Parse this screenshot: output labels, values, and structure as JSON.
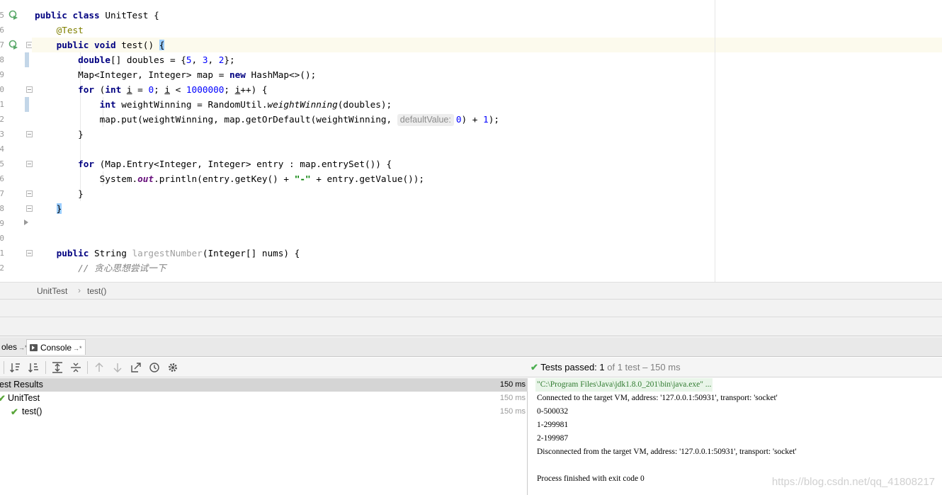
{
  "editor": {
    "line_numbers": [
      "5",
      "6",
      "7",
      "8",
      "9",
      "0",
      "1",
      "2",
      "3",
      "4",
      "5",
      "6",
      "7",
      "8",
      "9",
      "0",
      "1",
      "2"
    ],
    "code_lines": [
      {
        "id": "class-decl",
        "text": "public class UnitTest {"
      },
      {
        "id": "annotation",
        "text": "@Test"
      },
      {
        "id": "method-decl",
        "text": "public void test() {"
      },
      {
        "id": "doubles",
        "text": "double[] doubles = {5, 3, 2};"
      },
      {
        "id": "map-decl",
        "text": "Map<Integer, Integer> map = new HashMap<>();"
      },
      {
        "id": "for-loop",
        "text": "for (int i = 0; i < 1000000; i++) {"
      },
      {
        "id": "weight",
        "text": "int weightWinning = RandomUtil.weightWinning(doubles);"
      },
      {
        "id": "map-put",
        "text": "map.put(weightWinning, map.getOrDefault(weightWinning, defaultValue: 0) + 1);"
      },
      {
        "id": "close1",
        "text": "}"
      },
      {
        "id": "blank1",
        "text": ""
      },
      {
        "id": "for-entry",
        "text": "for (Map.Entry<Integer, Integer> entry : map.entrySet()) {"
      },
      {
        "id": "println",
        "text": "System.out.println(entry.getKey() + \"-\" + entry.getValue());"
      },
      {
        "id": "close2",
        "text": "}"
      },
      {
        "id": "close3",
        "text": "}"
      },
      {
        "id": "blank2",
        "text": ""
      },
      {
        "id": "blank3",
        "text": ""
      },
      {
        "id": "largest",
        "text": "public String largestNumber(Integer[] nums) {"
      },
      {
        "id": "comment",
        "text": "// 贪心思想尝试一下"
      }
    ],
    "tokens": {
      "public": "public",
      "class": "class",
      "class_name": "UnitTest {",
      "annotation": "@Test",
      "void": "void",
      "method": "test() ",
      "double_kw": "double",
      "doubles_rest": "[] doubles = {",
      "n5": "5",
      "n3": "3",
      "n2": "2",
      "doubles_end": "};",
      "map_type": "Map<Integer, Integer> map = ",
      "new": "new",
      "hashmap": " HashMap<>();",
      "for": "for",
      "int": "int",
      "i": "i",
      "n0": "0",
      "n1000000": "1000000",
      "iplusplus": "++) {",
      "weight_decl": " weightWinning = RandomUtil.",
      "weight_method": "weightWinning",
      "weight_args": "(doubles);",
      "put_start": "map.put(weightWinning, map.getOrDefault(weightWinning, ",
      "hint": "defaultValue:",
      "n0b": "0",
      "put_mid": ") + ",
      "n1": "1",
      "put_end": ");",
      "close": "}",
      "entry_loop": " (Map.Entry<Integer, Integer> entry : map.entrySet()) {",
      "system": "System.",
      "out": "out",
      "println_start": ".println(entry.getKey() + ",
      "dash": "\"-\"",
      "println_end": " + entry.getValue());",
      "string_type": " String ",
      "largest_name": "largestNumber",
      "largest_args": "(Integer[] nums) {",
      "comment": "// 贪心思想尝试一下"
    }
  },
  "breadcrumb": {
    "items": [
      "UnitTest",
      "test()"
    ],
    "separator": "›"
  },
  "tool_tabs": {
    "items": [
      {
        "label": "oles",
        "pin": "→*"
      },
      {
        "label": "Console",
        "pin": "→*"
      }
    ]
  },
  "toolbar": {
    "icons": [
      "sort-alpha-icon",
      "sort-duration-icon",
      "expand-all-icon",
      "collapse-all-icon",
      "prev-failed-icon",
      "next-failed-icon",
      "export-icon",
      "history-icon",
      "settings-icon"
    ],
    "status": {
      "check": "✔",
      "label": "Tests passed: 1",
      "rest": " of 1 test – 150 ms"
    }
  },
  "test_tree": {
    "rows": [
      {
        "label": "est Results",
        "duration": "150 ms"
      },
      {
        "label": "UnitTest",
        "duration": "150 ms"
      },
      {
        "label": "test()",
        "duration": "150 ms"
      }
    ],
    "check": "✔"
  },
  "console": {
    "lines": [
      "\"C:\\Program Files\\Java\\jdk1.8.0_201\\bin\\java.exe\" ...",
      "Connected to the target VM, address: '127.0.0.1:50931', transport: 'socket'",
      "0-500032",
      "1-299981",
      "2-199987",
      "Disconnected from the target VM, address: '127.0.0.1:50931', transport: 'socket'",
      "",
      "Process finished with exit code 0"
    ],
    "watermark": "https://blog.csdn.net/qq_41808217"
  },
  "colors": {
    "keyword": "#000080",
    "annotation": "#808000",
    "number": "#0000ff",
    "string": "#008000",
    "pass_green": "#5aa63a",
    "current_line": "#fcfaed"
  }
}
